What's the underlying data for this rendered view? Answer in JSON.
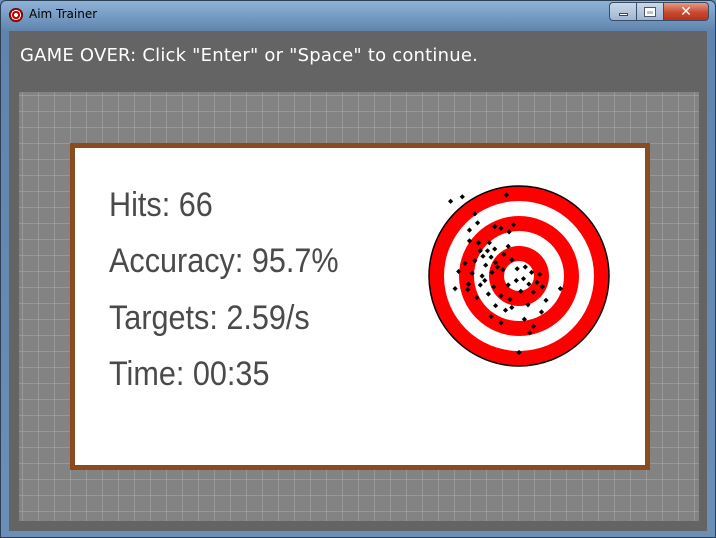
{
  "window": {
    "title": "Aim Trainer",
    "icon": "target-icon",
    "buttons": [
      "minimize-icon",
      "maximize-icon",
      "close-icon"
    ]
  },
  "status_message": "GAME OVER:  Click \"Enter\" or \"Space\" to continue.",
  "stats": {
    "hits_label": "Hits:",
    "hits_value": "66",
    "accuracy_label": "Accuracy:",
    "accuracy_value": "95.7%",
    "targets_label": "Targets:",
    "targets_value": "2.59/s",
    "time_label": "Time:",
    "time_value": "00:35"
  },
  "target": {
    "rings": 3,
    "colors": {
      "red": "#ff0000",
      "white": "#ffffff",
      "outline": "#000000",
      "marker": "#000000"
    },
    "hits": [
      [
        -0.76,
        -0.83
      ],
      [
        -0.63,
        -0.88
      ],
      [
        -0.14,
        -0.9
      ],
      [
        -0.49,
        -0.69
      ],
      [
        -0.55,
        -0.51
      ],
      [
        -0.46,
        -0.59
      ],
      [
        -0.27,
        -0.55
      ],
      [
        -0.2,
        -0.53
      ],
      [
        -0.11,
        -0.49
      ],
      [
        -0.06,
        -0.57
      ],
      [
        -0.55,
        -0.39
      ],
      [
        -0.45,
        -0.37
      ],
      [
        -0.33,
        -0.37
      ],
      [
        -0.43,
        -0.28
      ],
      [
        -0.35,
        -0.28
      ],
      [
        -0.27,
        -0.3
      ],
      [
        -0.4,
        -0.22
      ],
      [
        -0.31,
        -0.21
      ],
      [
        -0.49,
        -0.17
      ],
      [
        -0.6,
        -0.14
      ],
      [
        -0.37,
        -0.12
      ],
      [
        -0.26,
        -0.15
      ],
      [
        -0.17,
        -0.24
      ],
      [
        -0.08,
        -0.18
      ],
      [
        -0.67,
        -0.05
      ],
      [
        -0.52,
        -0.03
      ],
      [
        -0.41,
        0.0
      ],
      [
        -0.3,
        -0.04
      ],
      [
        -0.18,
        -0.07
      ],
      [
        -0.02,
        -0.08
      ],
      [
        0.07,
        -0.1
      ],
      [
        0.14,
        -0.04
      ],
      [
        -0.56,
        0.09
      ],
      [
        -0.43,
        0.1
      ],
      [
        -0.28,
        0.12
      ],
      [
        -0.12,
        0.1
      ],
      [
        -0.03,
        0.05
      ],
      [
        0.05,
        0.03
      ],
      [
        0.11,
        0.09
      ],
      [
        0.2,
        0.07
      ],
      [
        -0.71,
        0.14
      ],
      [
        -0.34,
        0.2
      ],
      [
        -0.2,
        0.22
      ],
      [
        -0.1,
        0.26
      ],
      [
        0.02,
        0.17
      ],
      [
        0.16,
        0.18
      ],
      [
        0.26,
        0.12
      ],
      [
        0.46,
        0.14
      ],
      [
        -0.26,
        0.33
      ],
      [
        -0.15,
        0.38
      ],
      [
        -0.08,
        0.35
      ],
      [
        0.1,
        0.32
      ],
      [
        0.25,
        0.4
      ],
      [
        -0.31,
        0.45
      ],
      [
        0.06,
        0.48
      ],
      [
        -0.2,
        0.52
      ],
      [
        0.16,
        0.56
      ],
      [
        0.12,
        0.63
      ],
      [
        0.3,
        0.27
      ],
      [
        -0.38,
        0.05
      ],
      [
        -0.47,
        0.24
      ],
      [
        0.0,
        0.85
      ],
      [
        -0.57,
        0.15
      ],
      [
        0.23,
        -0.02
      ],
      [
        -0.24,
        -0.1
      ],
      [
        -0.12,
        -0.33
      ]
    ]
  }
}
